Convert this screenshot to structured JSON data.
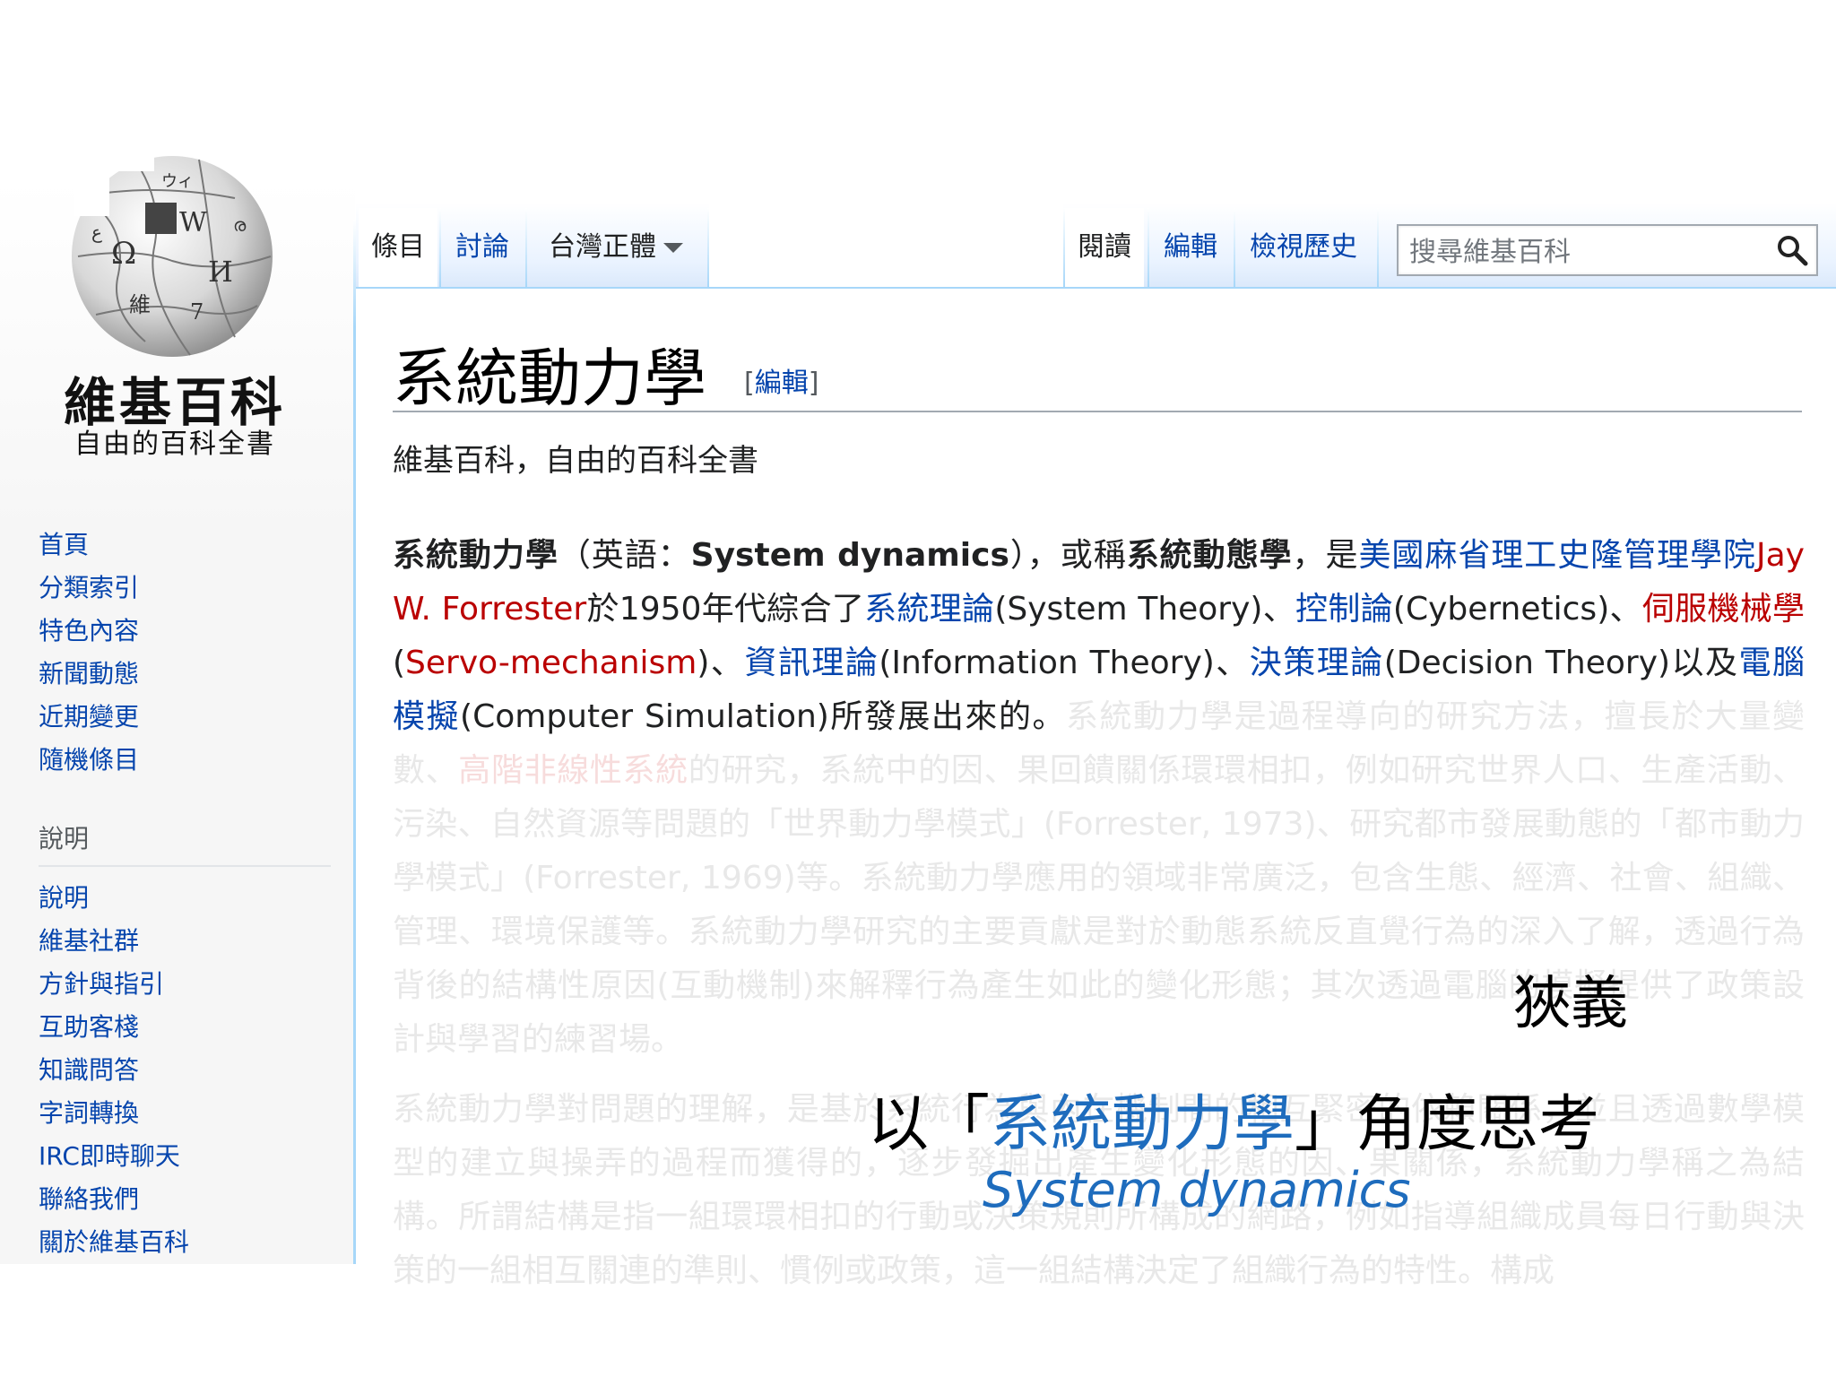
{
  "logo": {
    "title": "維基百科",
    "subtitle": "自由的百科全書"
  },
  "nav": {
    "main_items": [
      "首頁",
      "分類索引",
      "特色內容",
      "新聞動態",
      "近期變更",
      "隨機條目"
    ],
    "help_heading": "說明",
    "help_items": [
      "說明",
      "維基社群",
      "方針與指引",
      "互助客棧",
      "知識問答",
      "字詞轉換",
      "IRC即時聊天",
      "聯絡我們",
      "關於維基百科"
    ]
  },
  "tabs": {
    "article": "條目",
    "talk": "討論",
    "variant": "台灣正體",
    "read": "閱讀",
    "edit": "編輯",
    "history": "檢視歷史"
  },
  "search": {
    "placeholder": "搜尋維基百科"
  },
  "article": {
    "title": "系統動力學",
    "edit_open": "[",
    "edit_label": "編輯",
    "edit_close": "]",
    "site_sub": "維基百科，自由的百科全書",
    "p1": {
      "t1": "系統動力學",
      "t2": "（英語：",
      "t3": "System dynamics",
      "t4": "），或稱",
      "t5": "系統動態學",
      "t6": "，是",
      "l1": "美國麻省理工史隆管理學院",
      "r1": "Jay W. Forrester",
      "t7": "於1950年代綜合了",
      "l2": "系統理論",
      "t8": "(System Theory)、",
      "l3": "控制論",
      "t9": "(Cybernetics)、",
      "r2": "伺服機械學",
      "t10": "(",
      "r3": "Servo-mechanism",
      "t11": ")、",
      "l4": "資訊理論",
      "t12": "(Information Theory)、",
      "l5": "決策理論",
      "t13": "(Decision Theory)以及",
      "l6": "電腦模擬",
      "t14": "(Computer Simulation)所發展出來的。",
      "f1": "系統動力學是過程導向的研究方法，擅長於大量變數、",
      "fr1": "高階非線性系統",
      "f2": "的研究，系統中的因、果回饋關係環環相扣，例如研究世界人口、生產活動、污染、自然資源等問題的「世界動力學模式」(Forrester, 1973)、研究都市發展動態的「都市動力學模式」(Forrester, 1969)等。系統動力學應用的領域非常廣泛，包含生態、經濟、社會、組織、管理、環境保護等。系統動力學研究的主要貢獻是對於動態系統反直覺行為的深入了解，透過行為背後的結構性原因(互動機制)來解釋行為產生如此的變化形態；其次透過電腦的模擬提供了政策設計與學習的練習場。"
    },
    "p2": "系統動力學對問題的理解，是基於系統行為與內在機制間的相互緊密的依賴關係，並且透過數學模型的建立與操弄的過程而獲得的，逐步發掘出產生變化形態的因、果關係，系統動力學稱之為結構。所謂結構是指一組環環相扣的行動或決策規則所構成的網路，例如指導組織成員每日行動與決策的一組相互關連的準則、慣例或政策，這一組結構決定了組織行為的特性。構成"
  },
  "overlay": {
    "narrow": "狹義",
    "prefix": "以「",
    "term": "系統動力學",
    "suffix": "」角度思考",
    "english": "System dynamics"
  },
  "colors": {
    "link": "#0645ad",
    "redlink": "#ba0000",
    "overlay_blue": "#1e6cbd",
    "tab_border": "#a7d7f9"
  }
}
